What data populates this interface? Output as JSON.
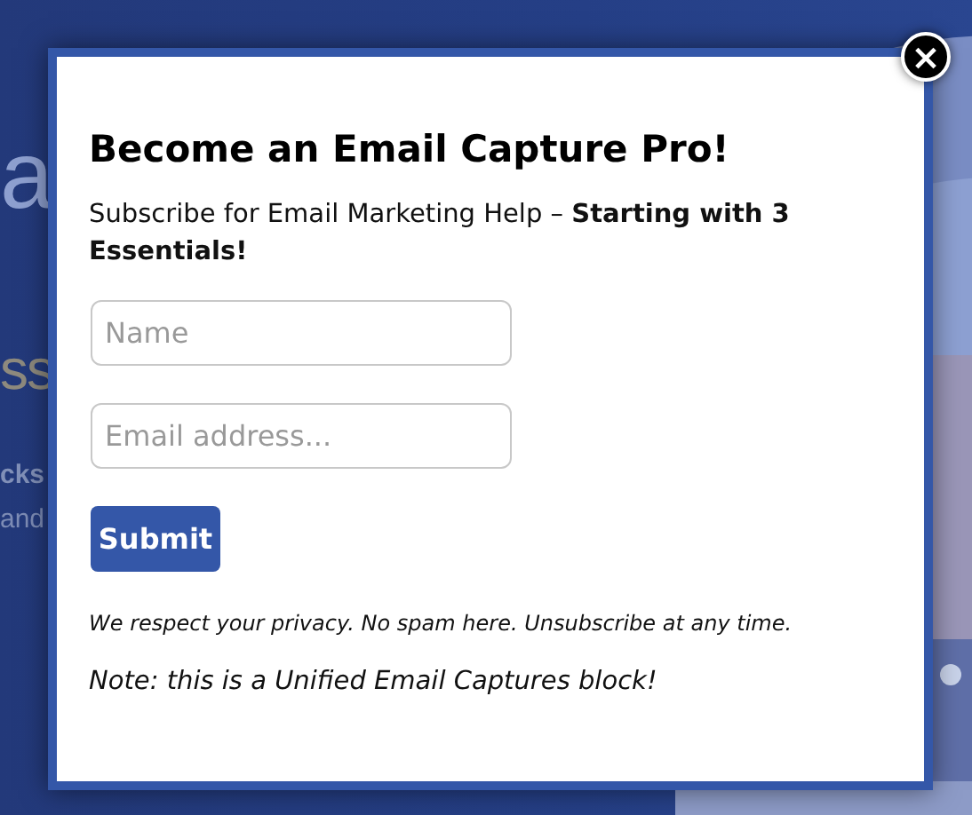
{
  "background": {
    "fragments": [
      {
        "text": "a",
        "kind": "headline"
      },
      {
        "text": "ss",
        "kind": "subhead"
      },
      {
        "text": "cks",
        "kind": "bold"
      },
      {
        "text": "and",
        "kind": "plain"
      }
    ]
  },
  "modal": {
    "title": "Become an Email Capture Pro!",
    "intro": "Subscribe for Email Marketing Help – **Starting with 3 Essentials!**",
    "fields": [
      {
        "placeholder": "Name"
      },
      {
        "placeholder": "Email address..."
      }
    ],
    "submit": "Submit",
    "privacy": "We respect your privacy. No spam here. Unsubscribe at any time.",
    "note": "Note: this is a Unified Email Captures block!",
    "close": "×"
  }
}
